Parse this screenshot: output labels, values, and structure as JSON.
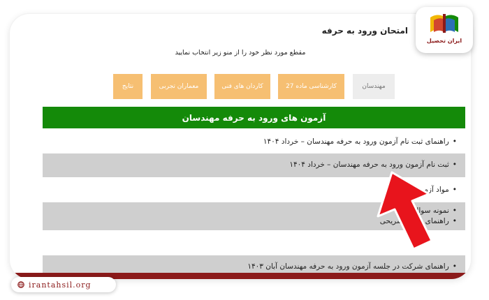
{
  "page": {
    "site_title": "امتحان ورود به حرفه",
    "instruction": "مقطع مورد نظر خود را از منو زیر انتخاب نمایید"
  },
  "tabs": [
    {
      "label": "مهندسان",
      "active": true
    },
    {
      "label": "کارشناسی ماده 27",
      "active": false
    },
    {
      "label": "کاردان های فنی",
      "active": false
    },
    {
      "label": "معماران تجربی",
      "active": false
    },
    {
      "label": "نتایج",
      "active": false
    }
  ],
  "section": {
    "header": "آزمون های ورود به حرفه مهندسان",
    "rows": [
      {
        "lines": [
          "راهنمای ثبت نام آزمون ورود به حرفه مهندسان – خرداد ۱۴۰۴"
        ],
        "bulleted": true,
        "shaded": false
      },
      {
        "lines": [
          "ثبت نام آزمون ورود به حرفه مهندسان – خرداد ۱۴۰۴"
        ],
        "bulleted": true,
        "shaded": true
      },
      {
        "lines": [
          "مواد آزمون"
        ],
        "bulleted": true,
        "shaded": false
      },
      {
        "lines": [
          "نمونه سوالات",
          "راهنمای پاسخ تشریحی"
        ],
        "bulleted": true,
        "shaded": true
      },
      {
        "lines": [],
        "bulleted": false,
        "shaded": false
      },
      {
        "lines": [
          "راهنمای شرکت در جلسه آزمون ورود به حرفه مهندسان آبان ۱۴۰۳"
        ],
        "bulleted": true,
        "shaded": true
      }
    ]
  },
  "annotation": {
    "arrow_color": "#e8141c"
  },
  "brand": {
    "logo_text": "ایران تحصیل",
    "url": "irantahsil.org",
    "primary_color": "#8b1a1a",
    "accent_green": "#148a09",
    "tab_color": "#f6bf72"
  }
}
